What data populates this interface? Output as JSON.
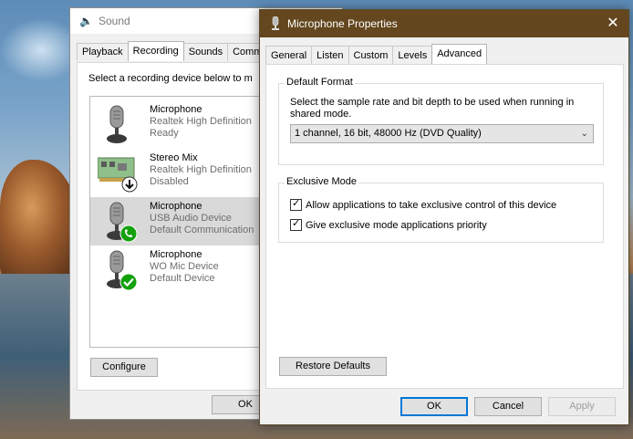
{
  "sound_window": {
    "title": "Sound",
    "tabs": [
      "Playback",
      "Recording",
      "Sounds",
      "Commu"
    ],
    "hint": "Select a recording device below to m",
    "devices": [
      {
        "name": "Microphone",
        "line1": "Realtek High Definition",
        "line2": "Ready",
        "status_icon": "none"
      },
      {
        "name": "Stereo Mix",
        "line1": "Realtek High Definition",
        "line2": "Disabled",
        "status_icon": "down-arrow-icon"
      },
      {
        "name": "Microphone",
        "line1": "USB Audio Device",
        "line2": "Default Communication",
        "status_icon": "phone-icon"
      },
      {
        "name": "Microphone",
        "line1": "WO Mic Device",
        "line2": "Default Device",
        "status_icon": "checkmark-icon"
      }
    ],
    "configure_label": "Configure",
    "ok_label": "OK"
  },
  "props_window": {
    "title": "Microphone Properties",
    "close_label": "✕",
    "tabs": [
      "General",
      "Listen",
      "Custom",
      "Levels",
      "Advanced"
    ],
    "default_format": {
      "label": "Default Format",
      "description": "Select the sample rate and bit depth to be used when running in shared mode.",
      "selected": "1 channel, 16 bit, 48000 Hz (DVD Quality)"
    },
    "exclusive_mode": {
      "label": "Exclusive Mode",
      "options": [
        {
          "label": "Allow applications to take exclusive control of this device",
          "checked": true
        },
        {
          "label": "Give exclusive mode applications priority",
          "checked": true
        }
      ]
    },
    "restore_label": "Restore Defaults",
    "ok_label": "OK",
    "cancel_label": "Cancel",
    "apply_label": "Apply"
  },
  "colors": {
    "title_bar": "#64471f",
    "selected_row": "#d9d9d9",
    "default_button_border": "#0078d7",
    "status_green": "#13a10e"
  }
}
